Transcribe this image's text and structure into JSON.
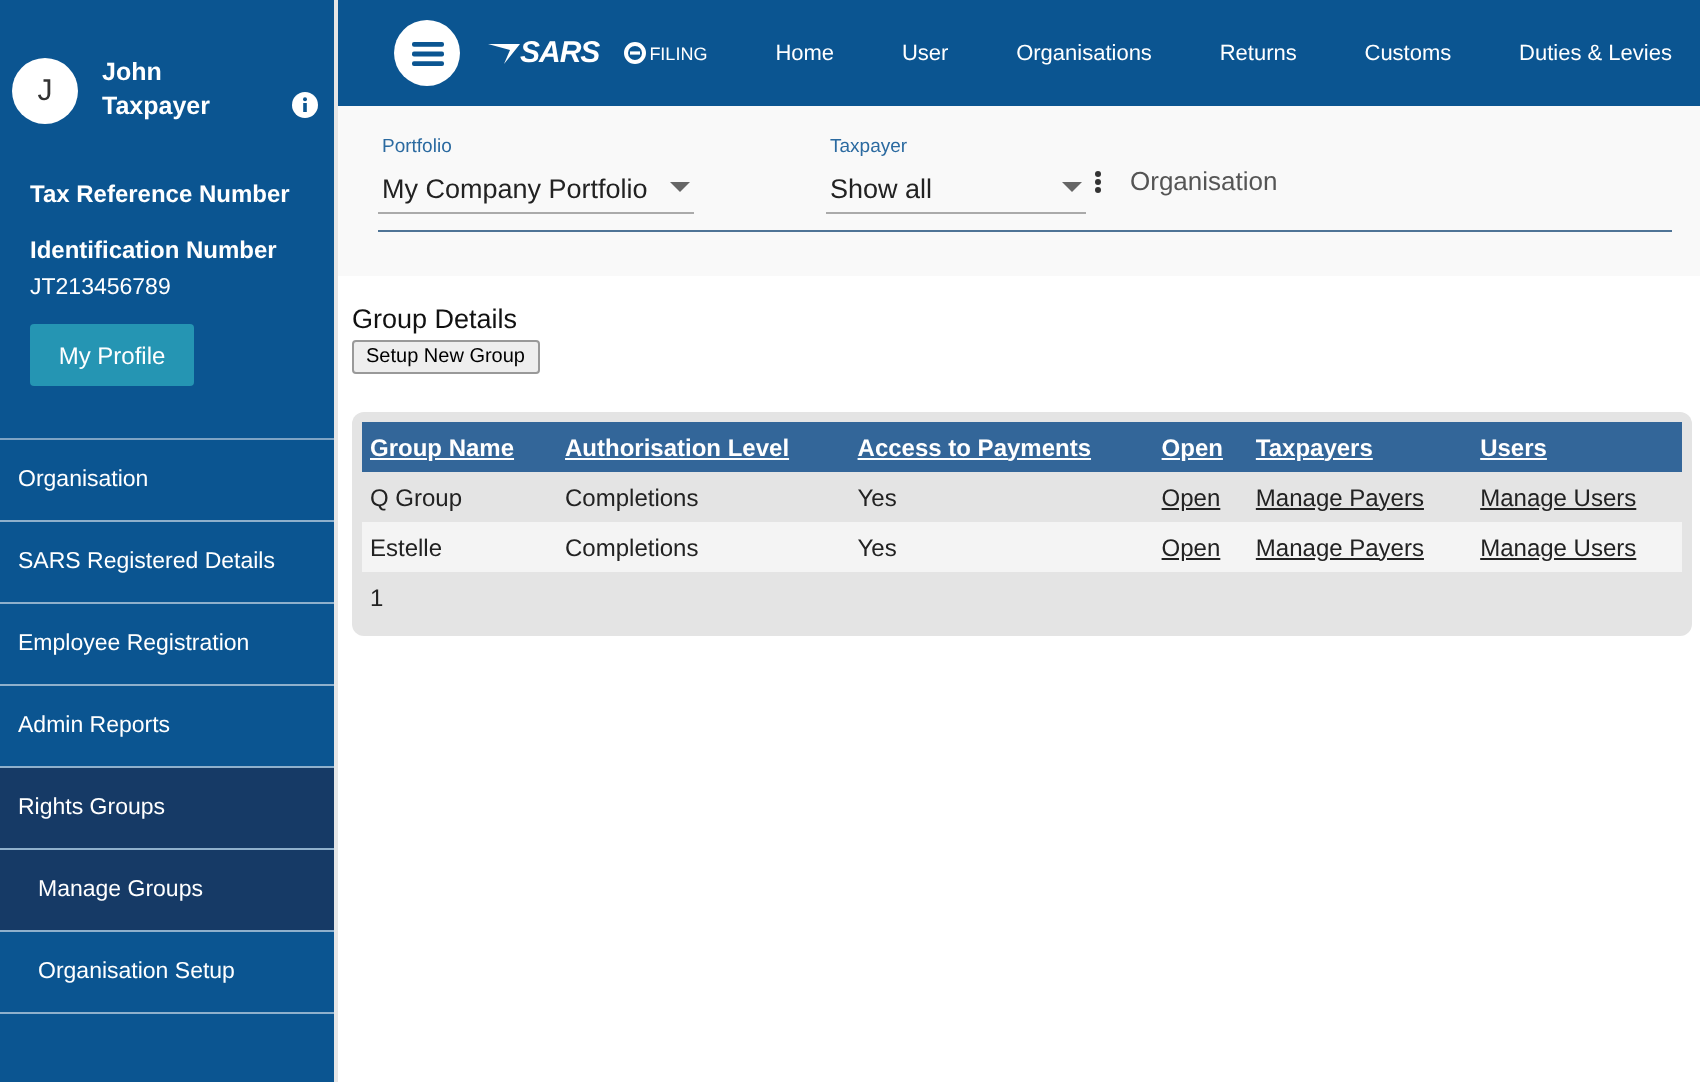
{
  "user": {
    "initial": "J",
    "name": "John Taxpayer"
  },
  "profile": {
    "fields": [
      {
        "label": "Tax Reference Number"
      },
      {
        "label": "Identification Number",
        "value": "JT213456789"
      }
    ],
    "button": "My Profile"
  },
  "sidebar": {
    "items": [
      {
        "label": "Organisation",
        "expanded": false
      },
      {
        "label": "SARS Registered Details",
        "expanded": false
      },
      {
        "label": "Employee Registration",
        "expanded": false
      },
      {
        "label": "Admin Reports",
        "expanded": false
      },
      {
        "label": "Rights Groups",
        "expanded": true,
        "children": [
          {
            "label": "Manage Groups",
            "selected": true
          },
          {
            "label": "Organisation Setup",
            "selected": false
          }
        ]
      }
    ]
  },
  "topbar": {
    "logo": "SARS",
    "logo_sub": "FILING",
    "nav": [
      "Home",
      "User",
      "Organisations",
      "Returns",
      "Customs",
      "Duties & Levies"
    ]
  },
  "filters": {
    "portfolio": {
      "label": "Portfolio",
      "value": "My Company Portfolio"
    },
    "taxpayer": {
      "label": "Taxpayer",
      "value": "Show all"
    },
    "context": "Organisation"
  },
  "section": {
    "title": "Group Details",
    "button": "Setup New Group"
  },
  "table": {
    "columns": [
      "Group Name",
      "Authorisation Level",
      "Access to Payments",
      "Open",
      "Taxpayers",
      "Users"
    ],
    "rows": [
      [
        "Q Group",
        "Completions",
        "Yes",
        "Open",
        "Manage Payers",
        "Manage Users"
      ],
      [
        "Estelle",
        "Completions",
        "Yes",
        "Open",
        "Manage Payers",
        "Manage Users"
      ]
    ],
    "pager": "1"
  }
}
